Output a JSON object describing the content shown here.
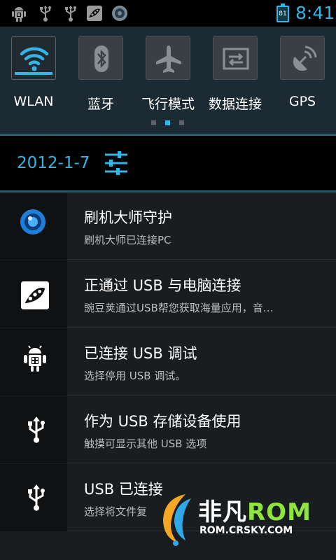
{
  "status_bar": {
    "icons": [
      "android-debug-icon",
      "usb-icon",
      "usb-icon",
      "wandoujia-icon",
      "shuaji-icon"
    ],
    "battery_level": "81",
    "clock": "8:41",
    "accent_color": "#33b5e5"
  },
  "toggles": [
    {
      "label": "WLAN",
      "icon": "wifi-icon",
      "on": true
    },
    {
      "label": "蓝牙",
      "icon": "bluetooth-icon",
      "on": false
    },
    {
      "label": "飞行模式",
      "icon": "airplane-icon",
      "on": false
    },
    {
      "label": "数据连接",
      "icon": "data-connection-icon",
      "on": false
    },
    {
      "label": "GPS",
      "icon": "gps-icon",
      "on": false
    }
  ],
  "page_indicator": {
    "count": 3,
    "active": 2
  },
  "date_bar": {
    "date": "2012-1-7",
    "settings_icon": "settings-sliders-icon"
  },
  "notifications": [
    {
      "icon": "shuaji-icon",
      "title": "刷机大师守护",
      "subtitle": "刷机大师已连接PC"
    },
    {
      "icon": "wandoujia-icon",
      "title": "正通过 USB 与电脑连接",
      "subtitle": "豌豆荚通过USB帮您获取海量应用，音…"
    },
    {
      "icon": "android-debug-icon",
      "title": "已连接 USB 调试",
      "subtitle": "选择停用 USB 调试。"
    },
    {
      "icon": "usb-icon",
      "title": "作为 USB 存储设备使用",
      "subtitle": "触摸可显示其他 USB 选项"
    },
    {
      "icon": "usb-icon",
      "title": "USB 已连接",
      "subtitle": "选择将文件复"
    }
  ],
  "watermark": {
    "brand": "非凡",
    "rom": "ROM",
    "url": "ROM.CRSKY.COM"
  }
}
